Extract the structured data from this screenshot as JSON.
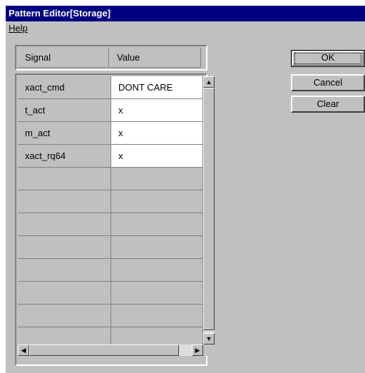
{
  "window": {
    "title": "Pattern Editor[Storage]"
  },
  "menu": {
    "items": [
      {
        "label": "Help"
      }
    ]
  },
  "grid": {
    "columns": [
      "Signal",
      "Value"
    ],
    "rows": [
      {
        "signal": "xact_cmd",
        "value": "DONT CARE"
      },
      {
        "signal": "t_act",
        "value": "x"
      },
      {
        "signal": "m_act",
        "value": "x"
      },
      {
        "signal": "xact_rq64",
        "value": "x"
      },
      {
        "signal": "",
        "value": ""
      },
      {
        "signal": "",
        "value": ""
      },
      {
        "signal": "",
        "value": ""
      },
      {
        "signal": "",
        "value": ""
      },
      {
        "signal": "",
        "value": ""
      },
      {
        "signal": "",
        "value": ""
      },
      {
        "signal": "",
        "value": ""
      },
      {
        "signal": "",
        "value": ""
      }
    ]
  },
  "buttons": {
    "ok": "OK",
    "cancel": "Cancel",
    "clear": "Clear"
  },
  "icons": {
    "scroll_up": "up-arrow-icon",
    "scroll_down": "down-arrow-icon",
    "scroll_left": "left-arrow-icon",
    "scroll_right": "right-arrow-icon"
  },
  "colors": {
    "title_bar": "#000080",
    "face": "#c0c0c0",
    "cell_editable": "#ffffff"
  }
}
